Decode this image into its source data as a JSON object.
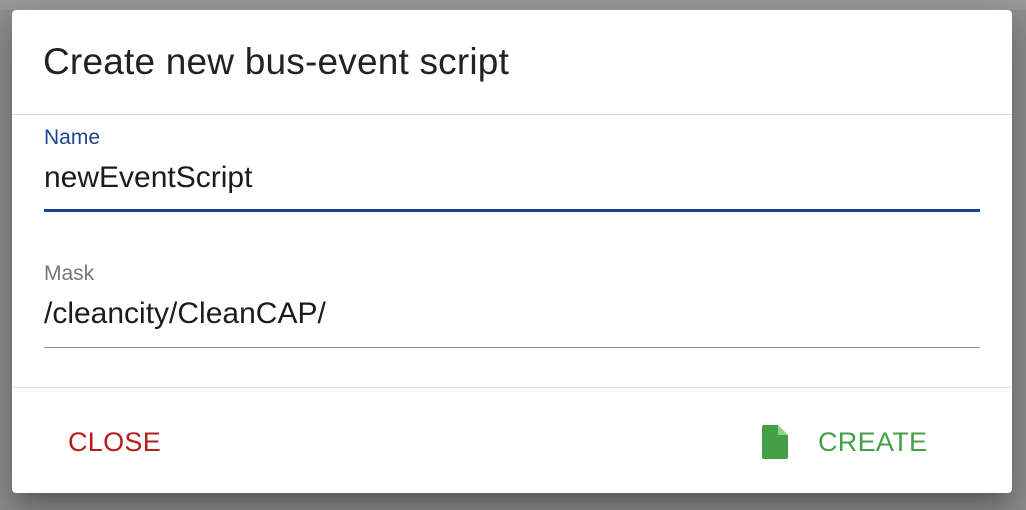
{
  "dialog": {
    "title": "Create new bus-event script"
  },
  "form": {
    "name": {
      "label": "Name",
      "value": "newEventScript"
    },
    "mask": {
      "label": "Mask",
      "value": "/cleancity/CleanCAP/"
    }
  },
  "actions": {
    "close_label": "CLOSE",
    "create_label": "CREATE",
    "create_icon": "file-icon"
  },
  "colors": {
    "accent": "#1e4490",
    "close": "#b71c1c",
    "create": "#43a047"
  }
}
